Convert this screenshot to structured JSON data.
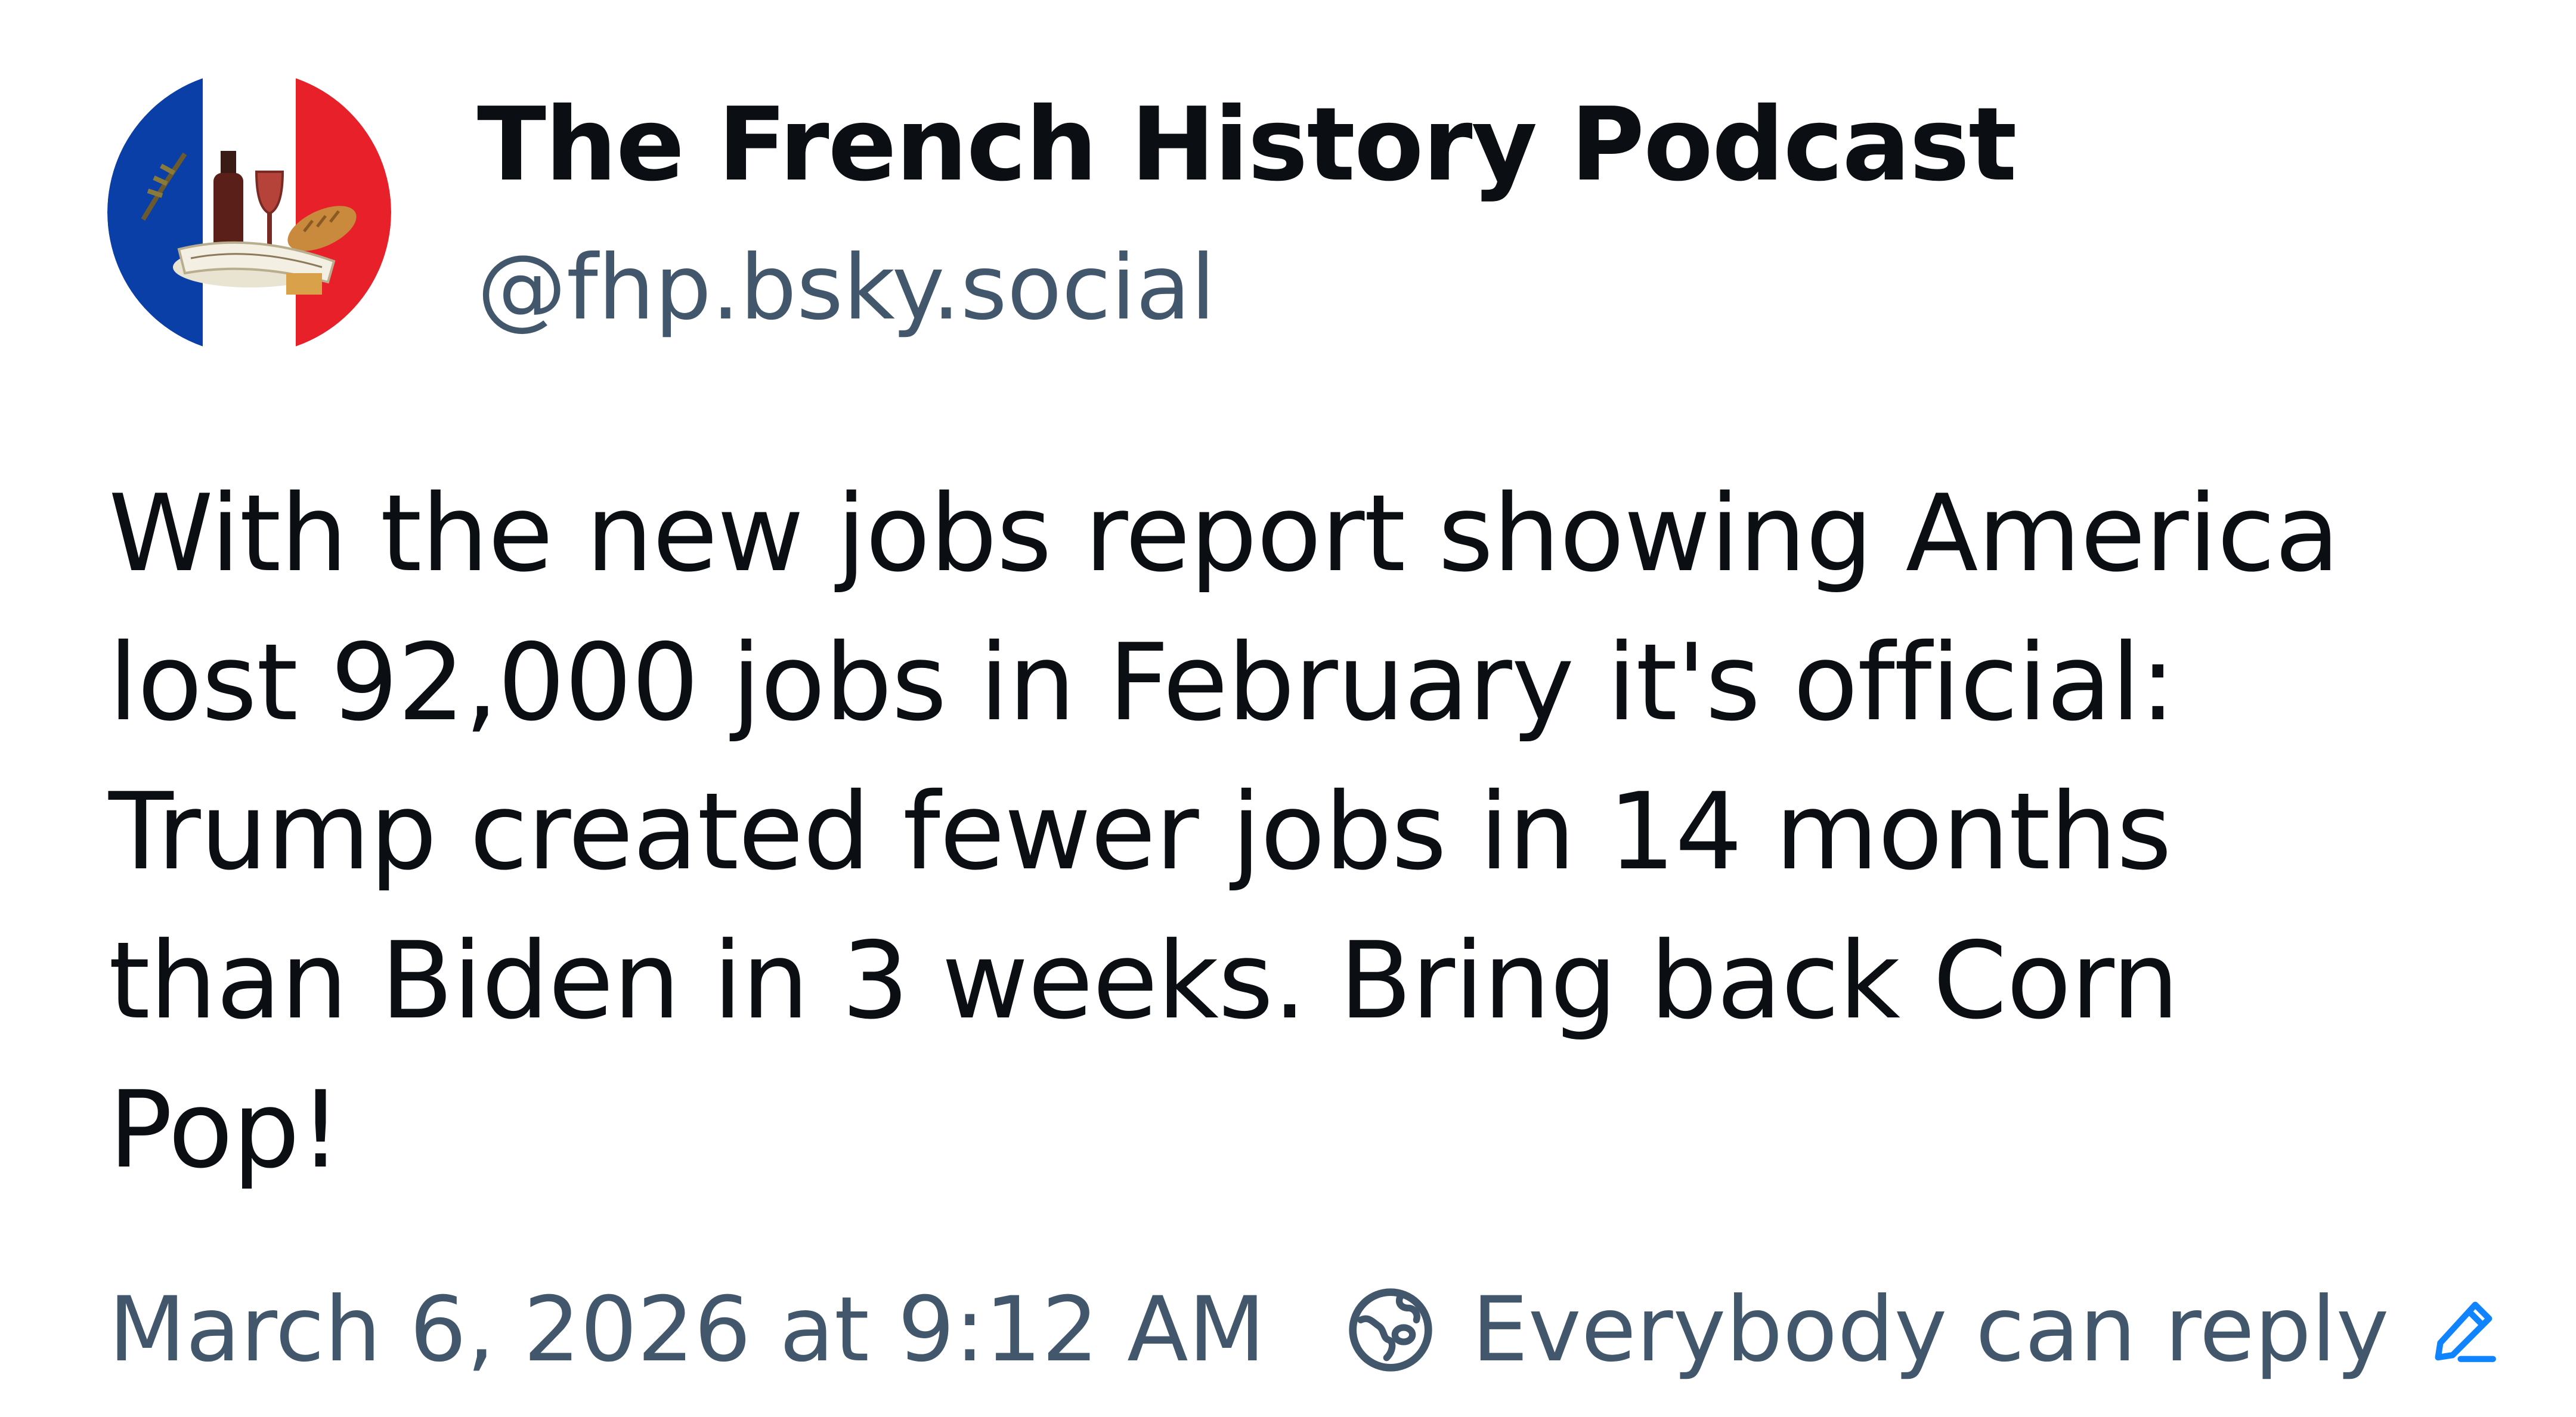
{
  "author": {
    "display_name": "The French History Podcast",
    "handle": "@fhp.bsky.social",
    "avatar_icon": "french-history-podcast-logo",
    "avatar_text": "The French History Podcast"
  },
  "post": {
    "lines": [
      "With the new jobs report showing America",
      "lost 92,000 jobs in February it's official:",
      "Trump created fewer jobs in 14 months",
      "than Biden in 3 weeks. Bring back Corn",
      "Pop!"
    ]
  },
  "meta": {
    "timestamp": "March 6, 2026 at 9:12 AM",
    "reply_setting": "Everybody can reply",
    "reply_icon": "globe-icon",
    "edit_icon": "pencil-icon"
  },
  "colors": {
    "text_primary": "#0b0f14",
    "text_secondary": "#42576c",
    "accent": "#1083fe",
    "flag_blue": "#0a3fa8",
    "flag_white": "#ffffff",
    "flag_red": "#e8202a"
  }
}
